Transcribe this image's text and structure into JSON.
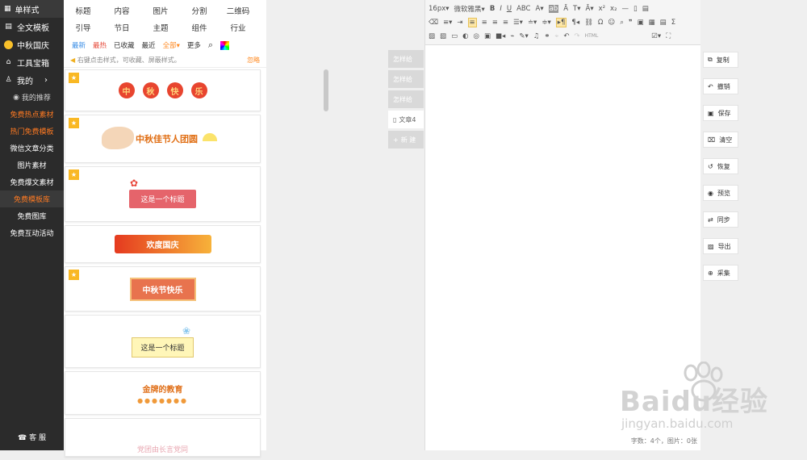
{
  "sidebar": {
    "top": "单样式",
    "items": [
      "全文模板",
      "中秋国庆",
      "工具宝箱",
      "我的"
    ],
    "recommend": "我的推荐",
    "subs": [
      "免费热点素材",
      "热门免费模板",
      "微信文章分类",
      "图片素材",
      "免费爆文素材",
      "免费模板库",
      "免费图库",
      "免费互动活动"
    ],
    "footer": "客 服"
  },
  "library": {
    "tabs": [
      "标题",
      "内容",
      "图片",
      "分割",
      "二维码",
      "引导",
      "节日",
      "主题",
      "组件",
      "行业"
    ],
    "filters": [
      "最新",
      "最热",
      "已收藏",
      "最近",
      "全部",
      "更多"
    ],
    "tip": "右键点击样式，可收藏、屏蔽样式。",
    "tip_action": "忽略",
    "cards": {
      "c1": [
        "中",
        "秋",
        "快",
        "乐"
      ],
      "c2": "中秋佳节人团圆",
      "c3": "这是一个标题",
      "c4": "欢度国庆",
      "c5": "中秋节快乐",
      "c6": "这是一个标题",
      "c7": "金牌的教育",
      "c8": "党团由长言党同"
    }
  },
  "docs": {
    "items": [
      "怎样给",
      "怎样给",
      "怎样给",
      "文章4"
    ],
    "new": "新 建"
  },
  "editor": {
    "font_size": "16px",
    "font_family": "微软雅黑",
    "status": "字数：4个，图片：0张"
  },
  "actions": [
    "复制",
    "撤销",
    "保存",
    "清空",
    "恢复",
    "预览",
    "同步",
    "导出",
    "采集"
  ],
  "watermark": {
    "brand": "Baidu经验",
    "url": "jingyan.baidu.com"
  }
}
